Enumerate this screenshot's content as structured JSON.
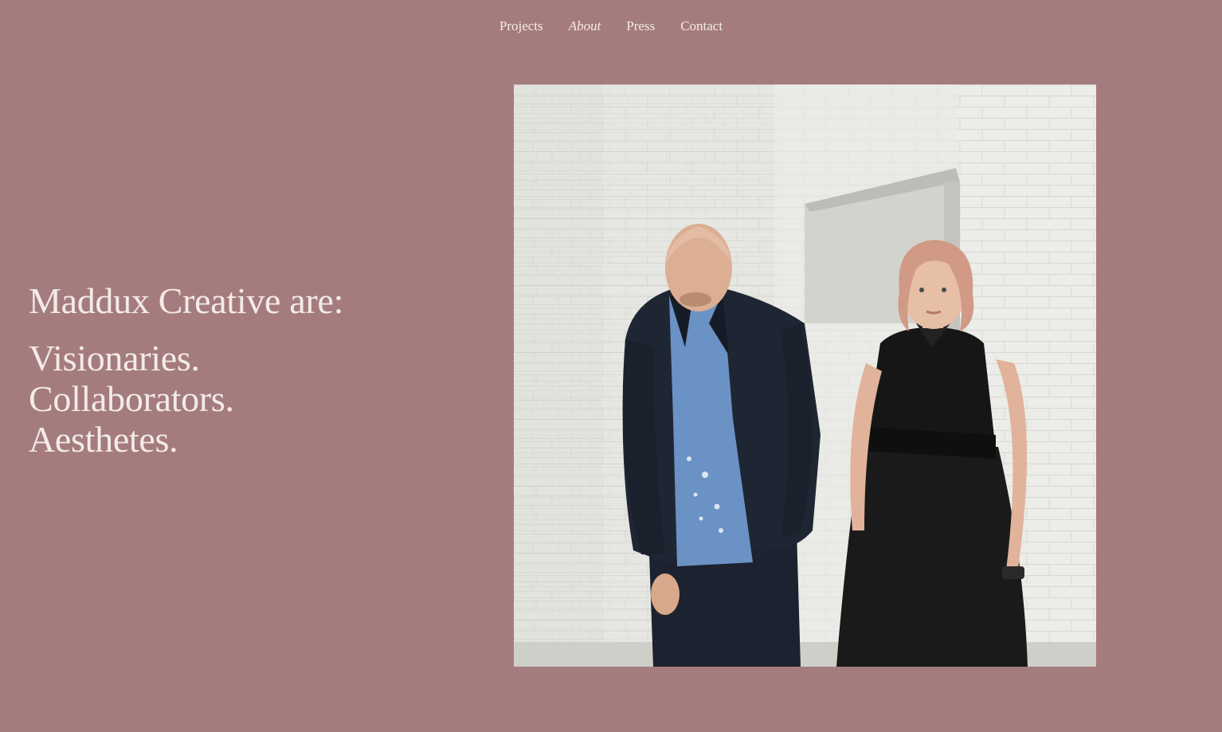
{
  "nav": {
    "items": [
      {
        "label": "Projects",
        "active": false
      },
      {
        "label": "About",
        "active": true
      },
      {
        "label": "Press",
        "active": false
      },
      {
        "label": "Contact",
        "active": false
      }
    ]
  },
  "hero": {
    "heading": "Maddux Creative are:",
    "lines": [
      "Visionaries.",
      "Collaborators.",
      "Aesthetes."
    ]
  },
  "photo": {
    "subject": "two people standing against a white-painted brick wall"
  },
  "colors": {
    "background": "#a57c7d",
    "text": "#f3ebe8"
  }
}
